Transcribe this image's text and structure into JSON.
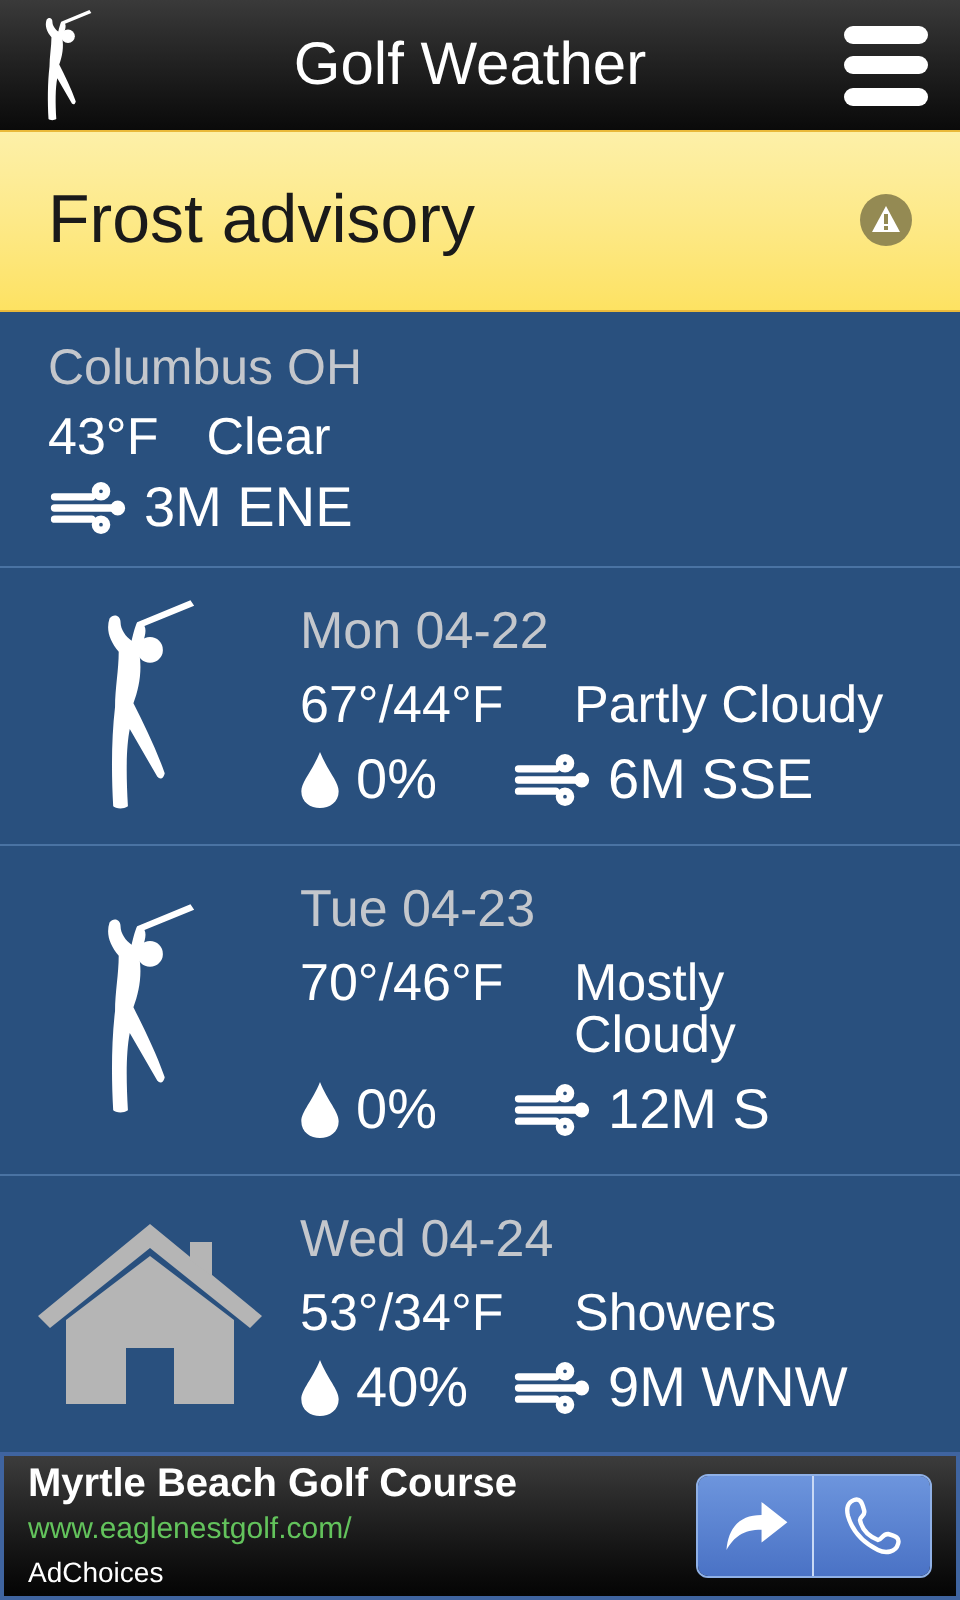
{
  "app_bar": {
    "title": "Golf Weather"
  },
  "alert": {
    "text": "Frost advisory"
  },
  "current": {
    "location": "Columbus OH",
    "temperature": "43°F",
    "condition": "Clear",
    "wind": "3M ENE"
  },
  "forecast": [
    {
      "kind": "golf",
      "date": "Mon 04-22",
      "temperature": "67°/44°F",
      "condition": "Partly Cloudy",
      "precipitation": "0%",
      "wind": "6M SSE"
    },
    {
      "kind": "golf",
      "date": "Tue 04-23",
      "temperature": "70°/46°F",
      "condition": "Mostly Cloudy",
      "precipitation": "0%",
      "wind": "12M S"
    },
    {
      "kind": "home",
      "date": "Wed 04-24",
      "temperature": "53°/34°F",
      "condition": "Showers",
      "precipitation": "40%",
      "wind": "9M WNW"
    }
  ],
  "ad": {
    "title": "Myrtle Beach Golf Course",
    "url": "www.eaglenestgolf.com/",
    "label": "AdChoices"
  }
}
